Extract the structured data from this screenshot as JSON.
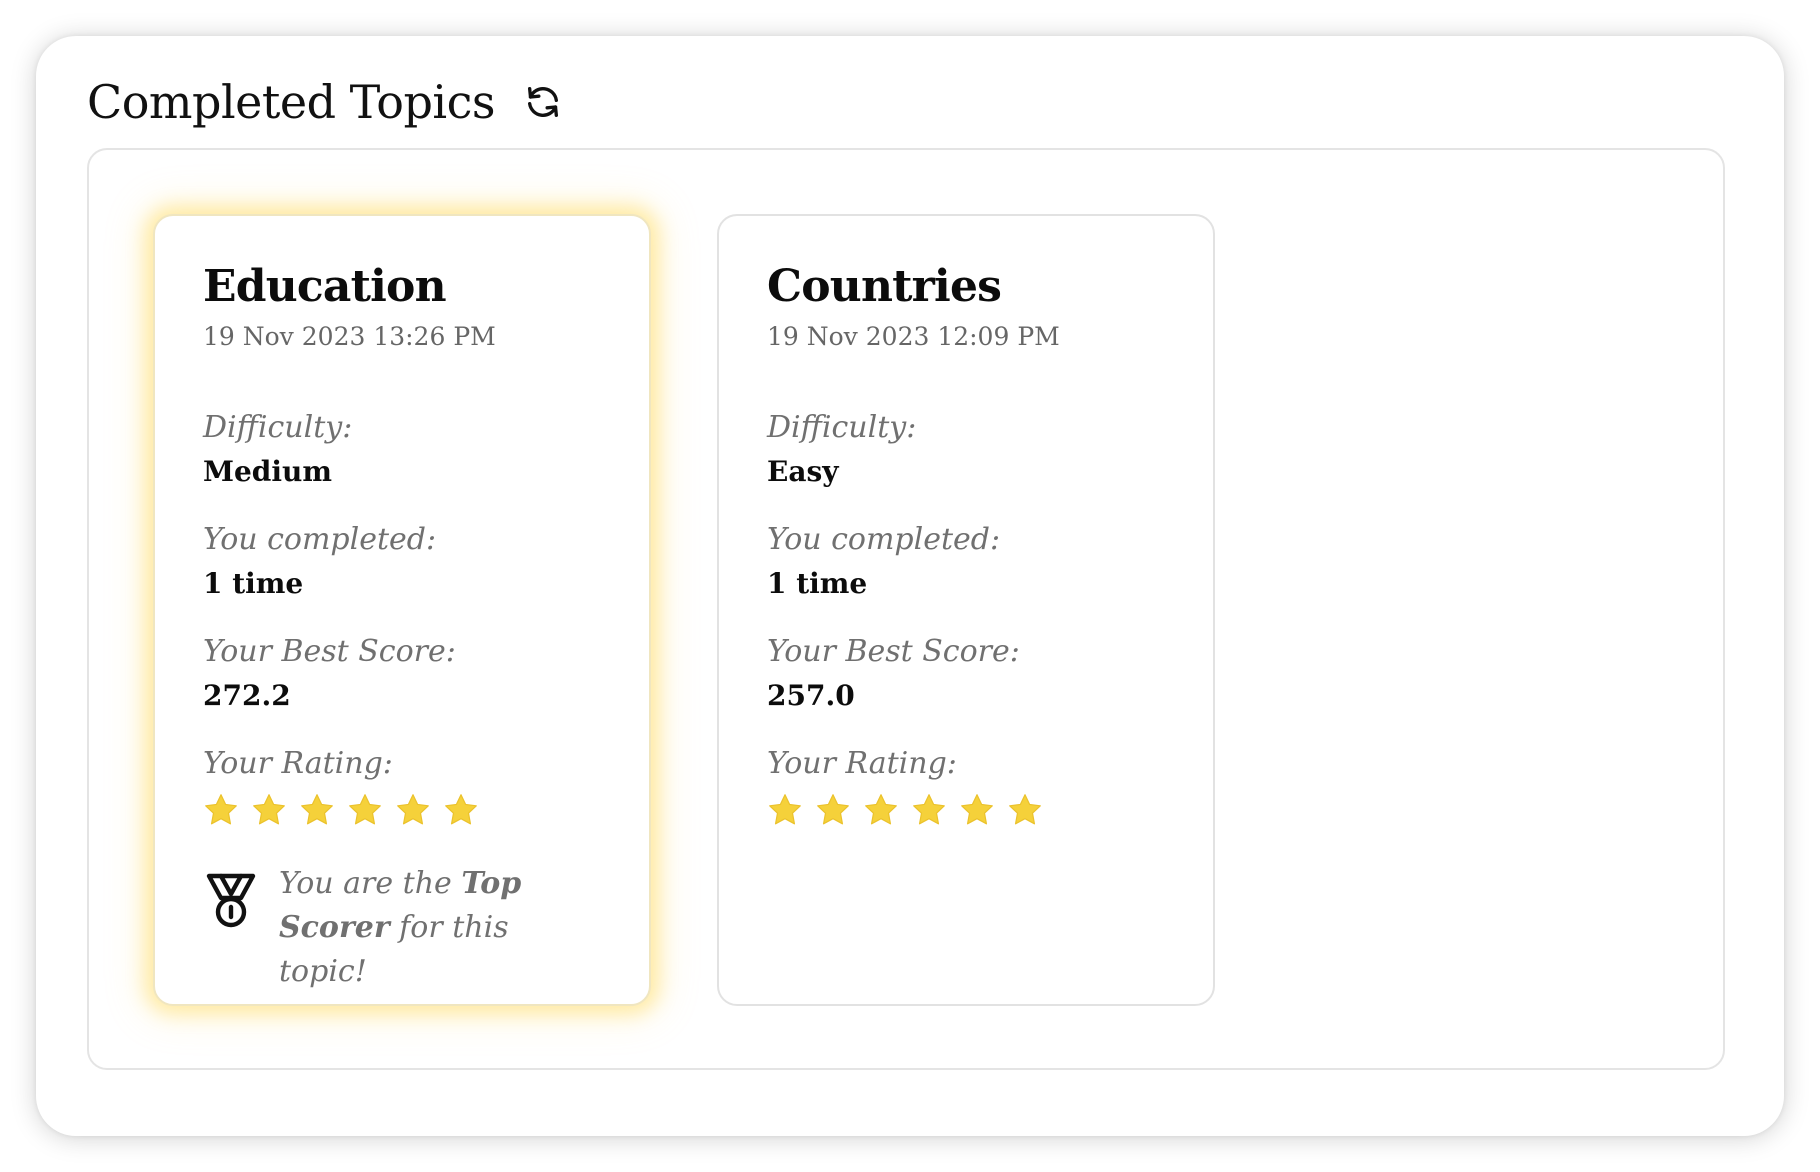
{
  "header": {
    "title": "Completed Topics",
    "refresh_icon": "refresh-icon"
  },
  "colors": {
    "star": "#F5D13A",
    "highlight_glow": "#FFD640",
    "label_gray": "#707070"
  },
  "topics": [
    {
      "name": "Education",
      "date": "19 Nov 2023 13:26 PM",
      "difficulty_label": "Difficulty:",
      "difficulty": "Medium",
      "completed_label": "You completed:",
      "completed": "1 time",
      "best_score_label": "Your Best Score:",
      "best_score": "272.2",
      "rating_label": "Your Rating:",
      "rating": 6,
      "rating_max": 6,
      "top_scorer": {
        "prefix": "You are the ",
        "emphasis": "Top Scorer",
        "suffix": " for this topic!",
        "icon": "medal-icon"
      }
    },
    {
      "name": "Countries",
      "date": "19 Nov 2023 12:09 PM",
      "difficulty_label": "Difficulty:",
      "difficulty": "Easy",
      "completed_label": "You completed:",
      "completed": "1 time",
      "best_score_label": "Your Best Score:",
      "best_score": "257.0",
      "rating_label": "Your Rating:",
      "rating": 6,
      "rating_max": 6
    }
  ]
}
